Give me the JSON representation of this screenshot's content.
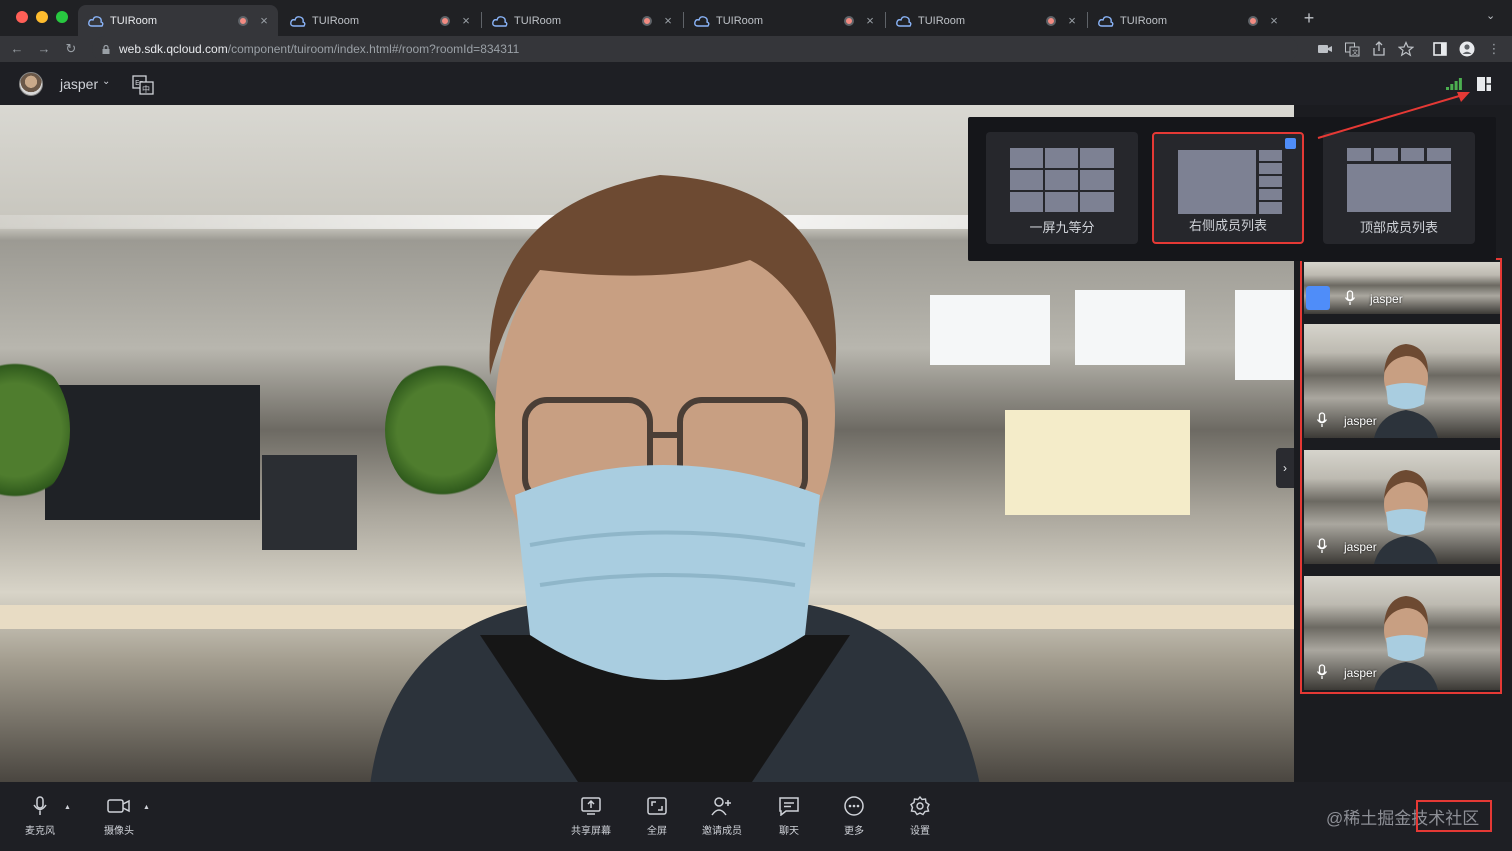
{
  "browser": {
    "tabs": [
      {
        "title": "TUIRoom",
        "active": true
      },
      {
        "title": "TUIRoom",
        "active": false
      },
      {
        "title": "TUIRoom",
        "active": false
      },
      {
        "title": "TUIRoom",
        "active": false
      },
      {
        "title": "TUIRoom",
        "active": false
      },
      {
        "title": "TUIRoom",
        "active": false
      }
    ],
    "new_tab": "+",
    "tab_close": "×",
    "url_host": "web.sdk.qcloud.com",
    "url_path": "/component/tuiroom/index.html#/room?roomId=834311"
  },
  "header": {
    "username": "jasper",
    "user_caret": "⌄",
    "icons": [
      "avatar",
      "language-switch-icon",
      "network-signal-icon",
      "layout-switch-icon"
    ]
  },
  "layout_popover": {
    "options": [
      {
        "label": "一屏九等分",
        "selected": false
      },
      {
        "label": "右侧成员列表",
        "selected": true
      },
      {
        "label": "顶部成员列表",
        "selected": false
      }
    ]
  },
  "member_list": {
    "members": [
      {
        "name": "jasper"
      },
      {
        "name": "jasper"
      },
      {
        "name": "jasper"
      },
      {
        "name": "jasper"
      }
    ],
    "collapse_glyph": "›"
  },
  "toolbar": {
    "mic_label": "麦克风",
    "camera_label": "摄像头",
    "share_label": "共享屏幕",
    "fullscreen_label": "全屏",
    "invite_label": "邀请成员",
    "chat_label": "聊天",
    "more_label": "更多",
    "settings_label": "设置",
    "caret": "▲"
  },
  "watermark": "@稀土掘金技术社区",
  "colors": {
    "highlight_red": "#e53935",
    "accent_blue": "#4f8df9",
    "background": "#1b1c20"
  }
}
